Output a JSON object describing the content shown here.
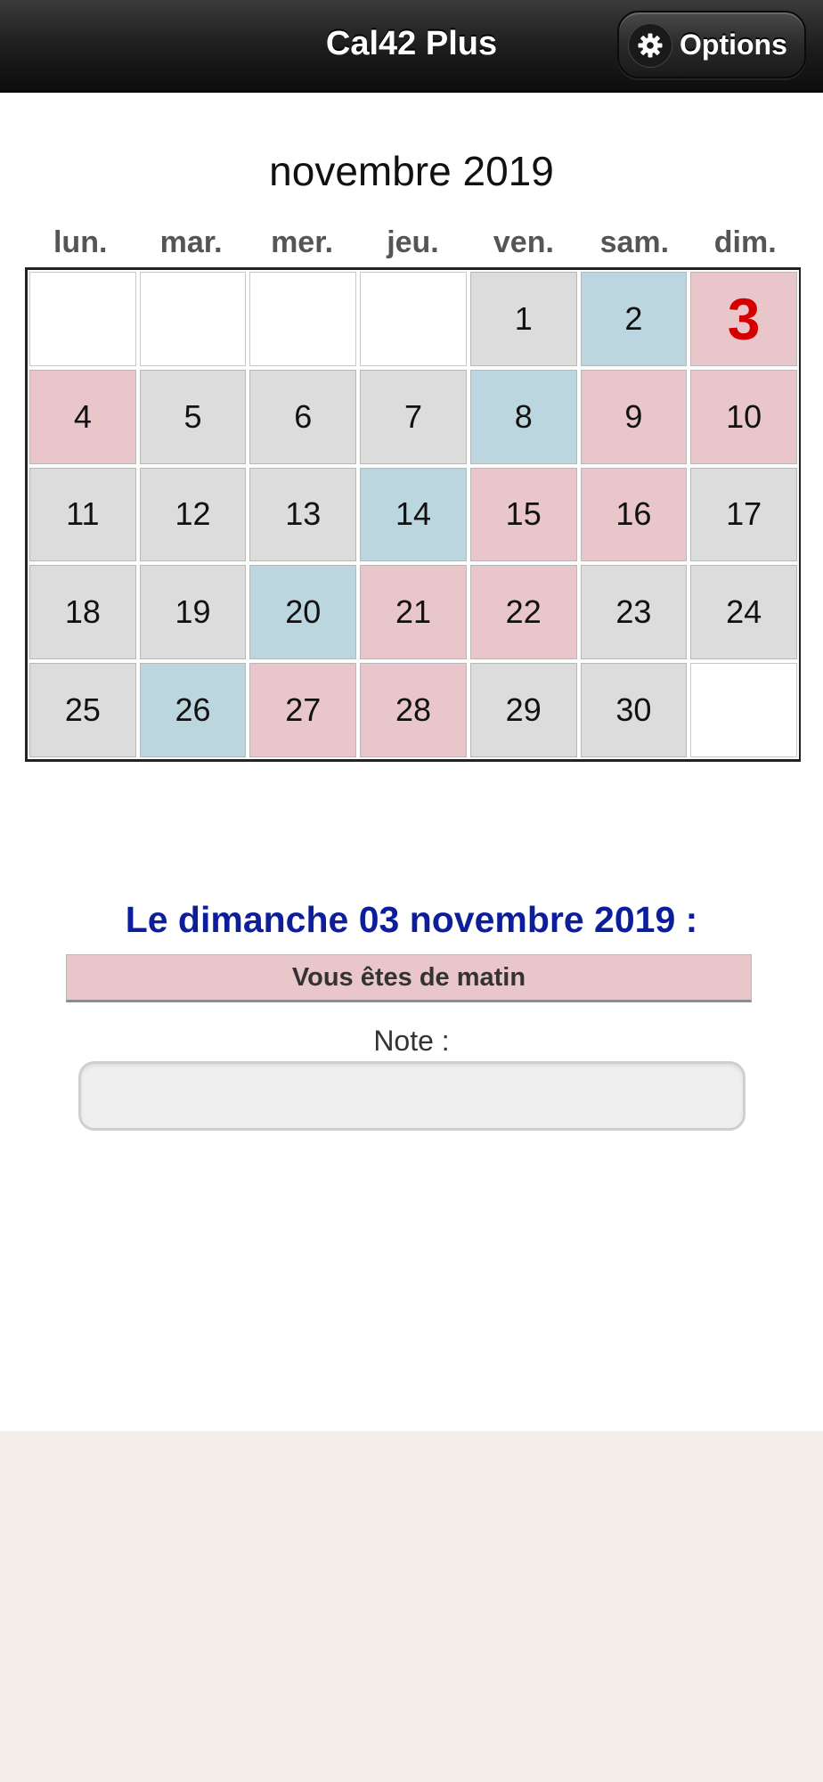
{
  "header": {
    "title": "Cal42 Plus",
    "options_label": "Options"
  },
  "calendar": {
    "month_title": "novembre 2019",
    "weekdays": [
      "lun.",
      "mar.",
      "mer.",
      "jeu.",
      "ven.",
      "sam.",
      "dim."
    ],
    "colors": {
      "gray": "#dcdcdc",
      "blue": "#bcd6df",
      "pink": "#e9c6c9",
      "white": "#ffffff",
      "selected_text": "#d40000"
    },
    "cells": [
      {
        "label": "",
        "color": "white"
      },
      {
        "label": "",
        "color": "white"
      },
      {
        "label": "",
        "color": "white"
      },
      {
        "label": "",
        "color": "white"
      },
      {
        "label": "1",
        "color": "gray"
      },
      {
        "label": "2",
        "color": "blue"
      },
      {
        "label": "3",
        "color": "pink",
        "selected": true
      },
      {
        "label": "4",
        "color": "pink"
      },
      {
        "label": "5",
        "color": "gray"
      },
      {
        "label": "6",
        "color": "gray"
      },
      {
        "label": "7",
        "color": "gray"
      },
      {
        "label": "8",
        "color": "blue"
      },
      {
        "label": "9",
        "color": "pink"
      },
      {
        "label": "10",
        "color": "pink"
      },
      {
        "label": "11",
        "color": "gray"
      },
      {
        "label": "12",
        "color": "gray"
      },
      {
        "label": "13",
        "color": "gray"
      },
      {
        "label": "14",
        "color": "blue"
      },
      {
        "label": "15",
        "color": "pink"
      },
      {
        "label": "16",
        "color": "pink"
      },
      {
        "label": "17",
        "color": "gray"
      },
      {
        "label": "18",
        "color": "gray"
      },
      {
        "label": "19",
        "color": "gray"
      },
      {
        "label": "20",
        "color": "blue"
      },
      {
        "label": "21",
        "color": "pink"
      },
      {
        "label": "22",
        "color": "pink"
      },
      {
        "label": "23",
        "color": "gray"
      },
      {
        "label": "24",
        "color": "gray"
      },
      {
        "label": "25",
        "color": "gray"
      },
      {
        "label": "26",
        "color": "blue"
      },
      {
        "label": "27",
        "color": "pink"
      },
      {
        "label": "28",
        "color": "pink"
      },
      {
        "label": "29",
        "color": "gray"
      },
      {
        "label": "30",
        "color": "gray"
      },
      {
        "label": "",
        "color": "white"
      }
    ]
  },
  "selected_day": {
    "heading": "Le dimanche 03 novembre 2019 :",
    "shift_text": "Vous êtes de matin",
    "shift_color": "#e9c6c9",
    "note_label": "Note :",
    "note_value": ""
  },
  "icons": {
    "options": "gear-icon"
  }
}
